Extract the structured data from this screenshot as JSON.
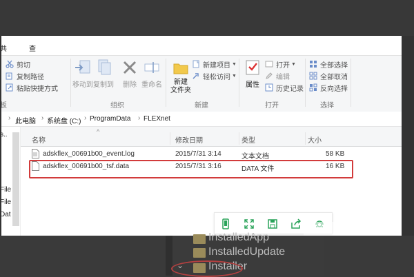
{
  "ribbon": {
    "tabs": [
      "共享",
      "查看"
    ],
    "clipboard": {
      "cut": "剪切",
      "copy_path": "复制路径",
      "paste_shortcut": "粘贴快捷方式",
      "label_partial": "板"
    },
    "organize": {
      "move_to": "移动到",
      "copy_to": "复制到",
      "delete": "删除",
      "rename": "重命名",
      "label": "组织"
    },
    "new": {
      "new_folder": "新建\n文件夹",
      "new_item": "新建项目",
      "easy_access": "轻松访问",
      "label": "新建"
    },
    "open": {
      "properties": "属性",
      "open": "打开",
      "edit": "编辑",
      "history": "历史记录",
      "label": "打开"
    },
    "select": {
      "select_all": "全部选择",
      "select_none": "全部取消",
      "invert": "反向选择",
      "label": "选择"
    }
  },
  "address": {
    "crumbs": [
      "此电脑",
      "系统盘 (C:)",
      "ProgramData",
      "FLEXnet"
    ]
  },
  "nav": {
    "items": [
      "s..",
      "File",
      "File",
      "Dat"
    ]
  },
  "columns": {
    "name": "名称",
    "modified": "修改日期",
    "type": "类型",
    "size": "大小"
  },
  "files": [
    {
      "name": "adskflex_00691b00_event.log",
      "modified": "2015/7/31 3:14",
      "type": "文本文档",
      "size": "58 KB"
    },
    {
      "name": "adskflex_00691b00_tsf.data",
      "modified": "2015/7/31 3:16",
      "type": "DATA 文件",
      "size": "16 KB"
    }
  ],
  "background_tree": {
    "items": [
      "InstalledApp",
      "InstalledUpdate",
      "Installer"
    ]
  },
  "colors": {
    "highlight": "#d23b3b",
    "toolbar_icon": "#2aa35a",
    "ribbon_bg": "#f5f6f7"
  }
}
